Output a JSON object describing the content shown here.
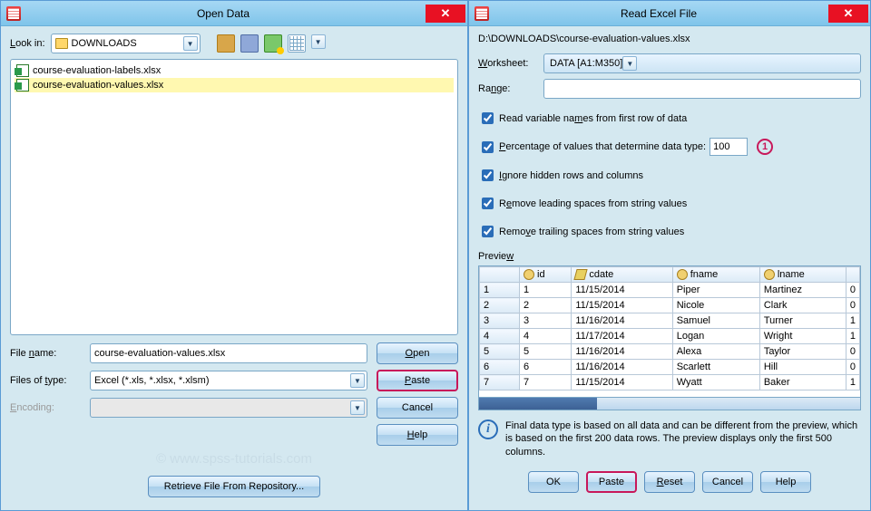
{
  "left": {
    "title": "Open Data",
    "look_in_label": "Look in:",
    "look_in_value": "DOWNLOADS",
    "files": [
      {
        "name": "course-evaluation-labels.xlsx",
        "selected": false
      },
      {
        "name": "course-evaluation-values.xlsx",
        "selected": true
      }
    ],
    "file_name_label": "File name:",
    "file_name_value": "course-evaluation-values.xlsx",
    "file_type_label": "Files of type:",
    "file_type_value": "Excel (*.xls, *.xlsx, *.xlsm)",
    "encoding_label": "Encoding:",
    "buttons": {
      "open": "Open",
      "paste": "Paste",
      "cancel": "Cancel",
      "help": "Help"
    },
    "watermark": "© www.spss-tutorials.com",
    "retrieve": "Retrieve File From Repository..."
  },
  "right": {
    "title": "Read Excel File",
    "path": "D:\\DOWNLOADS\\course-evaluation-values.xlsx",
    "worksheet_label": "Worksheet:",
    "worksheet_value": "DATA [A1:M350]",
    "range_label": "Range:",
    "range_value": "",
    "chk1": "Read variable names from first row of data",
    "chk2": "Percentage of values that determine data type:",
    "pct_value": "100",
    "annotation": "1",
    "chk3": "Ignore hidden rows and columns",
    "chk4": "Remove leading spaces from string values",
    "chk5": "Remove trailing spaces from string values",
    "preview_label": "Preview",
    "columns": [
      "id",
      "cdate",
      "fname",
      "lname"
    ],
    "rows": [
      [
        "1",
        "1",
        "11/15/2014",
        "Piper",
        "Martinez",
        "0"
      ],
      [
        "2",
        "2",
        "11/15/2014",
        "Nicole",
        "Clark",
        "0"
      ],
      [
        "3",
        "3",
        "11/16/2014",
        "Samuel",
        "Turner",
        "1"
      ],
      [
        "4",
        "4",
        "11/17/2014",
        "Logan",
        "Wright",
        "1"
      ],
      [
        "5",
        "5",
        "11/16/2014",
        "Alexa",
        "Taylor",
        "0"
      ],
      [
        "6",
        "6",
        "11/16/2014",
        "Scarlett",
        "Hill",
        "0"
      ],
      [
        "7",
        "7",
        "11/15/2014",
        "Wyatt",
        "Baker",
        "1"
      ]
    ],
    "info": "Final data type is based on all data and can be different from the preview, which is based on the first 200 data rows. The preview displays only the first 500 columns.",
    "buttons": {
      "ok": "OK",
      "paste": "Paste",
      "reset": "Reset",
      "cancel": "Cancel",
      "help": "Help"
    }
  }
}
